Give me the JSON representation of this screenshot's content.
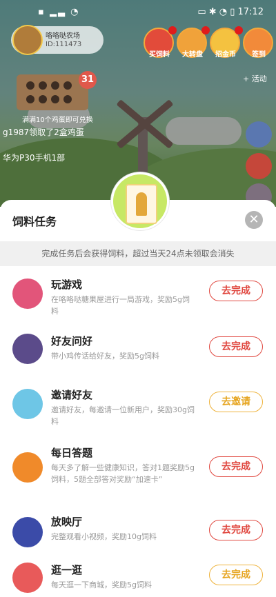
{
  "status_bar": {
    "left": "▪ ▂▃ ◔",
    "right": "▭ ✱ ◔ ▯ 17:12"
  },
  "background": {
    "user": {
      "name": "咯咯哒农场",
      "id": "ID:111473"
    },
    "top_buttons": [
      {
        "label": "买饲料"
      },
      {
        "label": "大转盘"
      },
      {
        "label": "招金币"
      },
      {
        "label": "签到"
      }
    ],
    "egg_count": "31",
    "egg_notice": "满满10个鸡蛋即可兑换",
    "broadcast_1": "g1987领取了2盒鸡蛋",
    "broadcast_2": "华为P30手机1部",
    "side_label": "+ 活动"
  },
  "sheet": {
    "title": "饲料任务",
    "notice": "完成任务后会获得饲料，超过当天24点未领取会消失",
    "tasks": [
      {
        "title": "玩游戏",
        "desc": "在咯咯哒糖果屋进行一局游戏，奖励5g饲料",
        "button": "去完成",
        "style": "red",
        "icon": "cartoon-girl-icon",
        "icon_color": "#e2557a"
      },
      {
        "title": "好友问好",
        "desc": "带小鸡传话给好友，奖励5g饲料",
        "button": "去完成",
        "style": "red",
        "icon": "share-icon",
        "icon_color": "#5b4b8a"
      },
      {
        "title": "邀请好友",
        "desc": "邀请好友，每邀请一位新用户，奖励30g饲料",
        "button": "去邀请",
        "style": "gold",
        "icon": "kids-icon",
        "icon_color": "#6ec6e6"
      },
      {
        "title": "每日答题",
        "desc": "每天多了解一些健康知识，答对1题奖励5g饲料，5题全部答对奖励“加速卡”",
        "button": "去完成",
        "style": "red",
        "icon": "pencil-icon",
        "icon_color": "#f08a2a"
      },
      {
        "title": "放映厅",
        "desc": "完整观看小视频，奖励10g饲料",
        "button": "去完成",
        "style": "red",
        "icon": "video-icon",
        "icon_color": "#3b4ba8"
      },
      {
        "title": "逛一逛",
        "desc": "每天逛一下商城，奖励5g饲料",
        "button": "去完成",
        "style": "gold",
        "icon": "planet-icon",
        "icon_color": "#e85a5a"
      }
    ]
  }
}
